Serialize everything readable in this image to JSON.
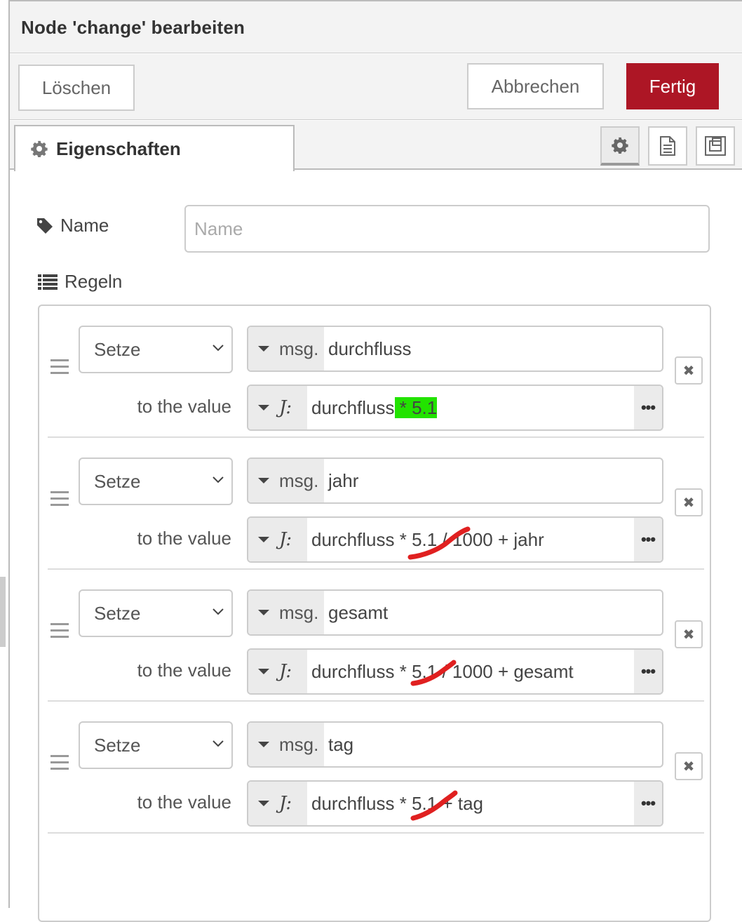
{
  "header": {
    "title": "Node 'change' bearbeiten"
  },
  "toolbar": {
    "delete_label": "Löschen",
    "cancel_label": "Abbrechen",
    "done_label": "Fertig",
    "done_color": "#ad1625"
  },
  "tabs": {
    "properties_label": "Eigenschaften"
  },
  "form": {
    "name_label": "Name",
    "name_placeholder": "Name",
    "name_value": "",
    "rules_label": "Regeln"
  },
  "rules": [
    {
      "action": "Setze",
      "prop_type": "msg.",
      "property": "durchfluss",
      "to_label": "to the value",
      "expr_type": "J:",
      "expr_prefix": "durchfluss",
      "expr_highlight": " * 5.1",
      "expr_rest": "",
      "highlight_color": "#22e300"
    },
    {
      "action": "Setze",
      "prop_type": "msg.",
      "property": "jahr",
      "to_label": "to the value",
      "expr_type": "J:",
      "expr_prefix": "durchfluss * ",
      "expr_struck": "5.1",
      "expr_rest": " / 1000 + jahr"
    },
    {
      "action": "Setze",
      "prop_type": "msg.",
      "property": "gesamt",
      "to_label": "to the value",
      "expr_type": "J:",
      "expr_prefix": "durchfluss * ",
      "expr_struck": "5.1",
      "expr_rest": " / 1000 + gesamt"
    },
    {
      "action": "Setze",
      "prop_type": "msg.",
      "property": "tag",
      "to_label": "to the value",
      "expr_type": "J:",
      "expr_prefix": "durchfluss * ",
      "expr_struck": "5.1",
      "expr_rest": " + tag"
    }
  ],
  "icons": {
    "gear": "gear-icon",
    "tag": "tag-icon",
    "list": "list-icon",
    "doc": "document-icon",
    "frame": "frame-icon",
    "remove": "remove-icon",
    "more": "ellipsis-icon",
    "strike_color": "#e02020"
  }
}
